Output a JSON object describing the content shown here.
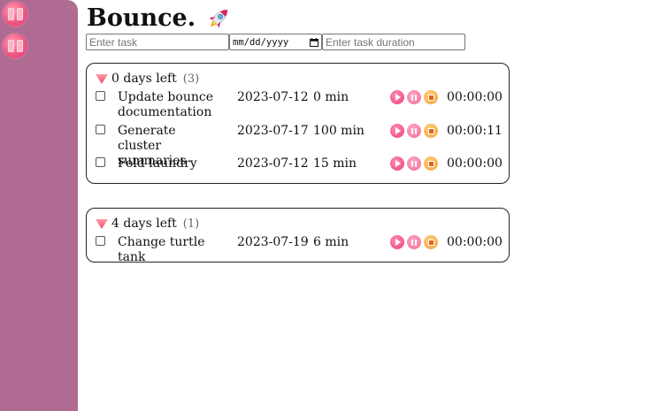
{
  "app": {
    "title": "Bounce.",
    "icon": "rocket-icon"
  },
  "sidebar": {
    "buttons": [
      {
        "icon": "pause-icon"
      },
      {
        "icon": "pause-icon"
      }
    ],
    "color": "#b06b93"
  },
  "form": {
    "task_placeholder": "Enter task",
    "date_placeholder": "mm/dd/yyyy",
    "duration_placeholder": "Enter task duration"
  },
  "groups": [
    {
      "label": "0 days left",
      "count": "(3)",
      "tasks": [
        {
          "name": "Update bounce documentation",
          "date": "2023-07-12",
          "duration": "0 min",
          "timer": "00:00:00"
        },
        {
          "name": "Generate cluster summaries",
          "date": "2023-07-17",
          "duration": "100 min",
          "timer": "00:00:11"
        },
        {
          "name": "Fold laundry",
          "date": "2023-07-12",
          "duration": "15 min",
          "timer": "00:00:00"
        }
      ]
    },
    {
      "label": "4 days left",
      "count": "(1)",
      "tasks": [
        {
          "name": "Change turtle tank",
          "date": "2023-07-19",
          "duration": "6 min",
          "timer": "00:00:00"
        }
      ]
    }
  ],
  "colors": {
    "accent": "#ec3d76",
    "stop": "#f4a23a"
  }
}
